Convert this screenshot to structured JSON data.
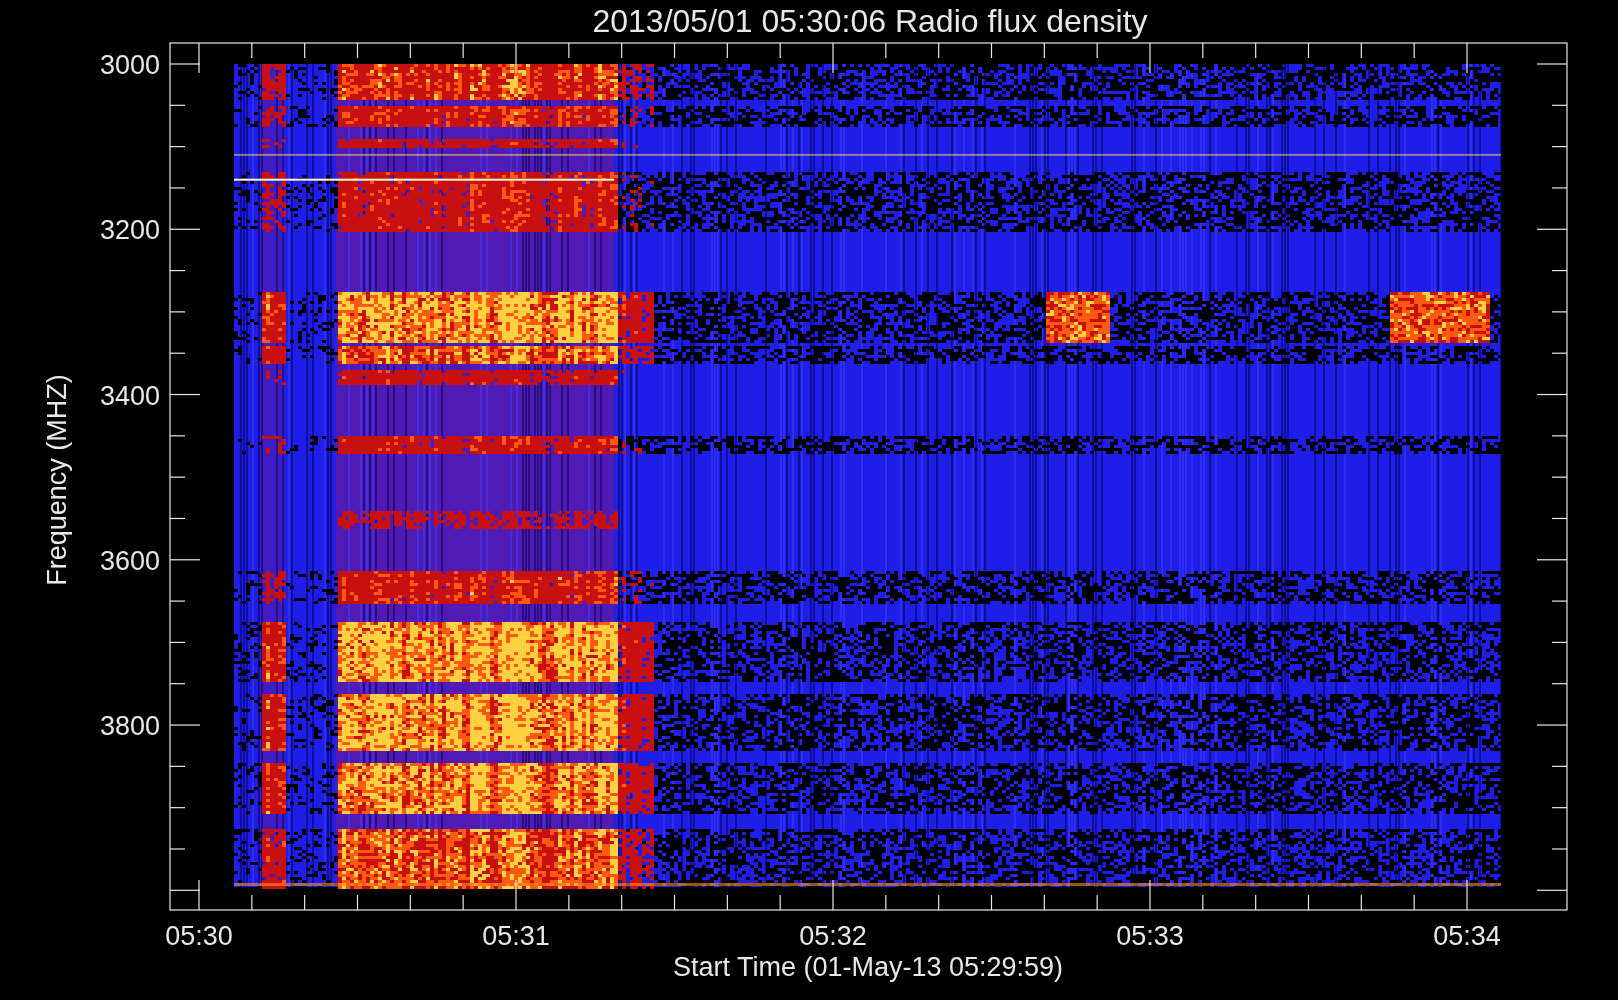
{
  "title": "2013/05/01 05:30:06 Radio flux density",
  "plot": {
    "ylabel": "Frequency (MHZ)",
    "xlabel": "Start Time (01-May-13 05:29:59)",
    "y_tick_labels": [
      "3000",
      "3200",
      "3400",
      "3600",
      "3800"
    ],
    "x_tick_labels": [
      "05:30",
      "05:31",
      "05:32",
      "05:33",
      "05:34"
    ]
  }
}
